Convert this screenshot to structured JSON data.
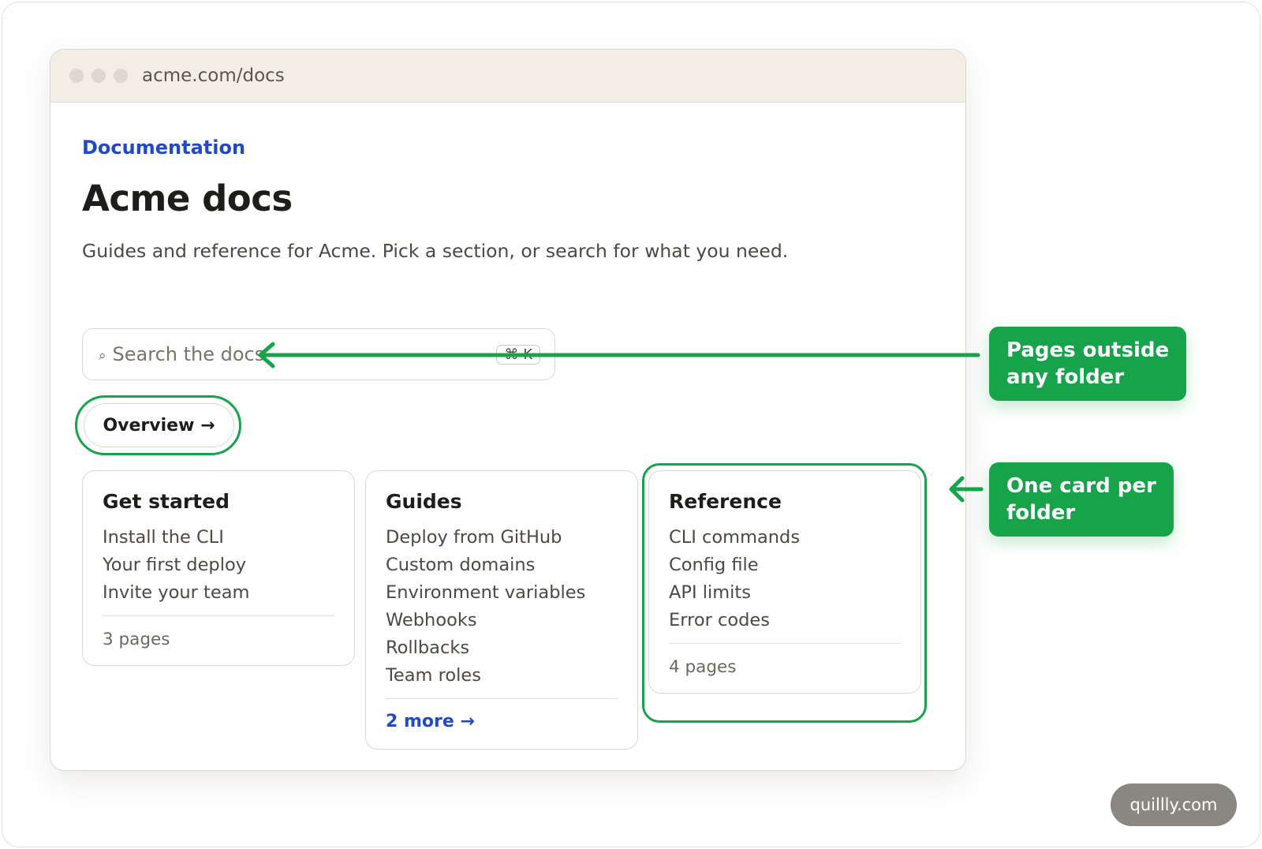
{
  "browser": {
    "url": "acme.com/docs"
  },
  "page": {
    "eyebrow": "Documentation",
    "title": "Acme docs",
    "subtitle": "Guides and reference for Acme. Pick a section, or search for what you need.",
    "search": {
      "placeholder": "Search the docs",
      "shortcut": "⌘ K",
      "icon": "search-icon"
    },
    "overview_label": "Overview →"
  },
  "cards": [
    {
      "title": "Get started",
      "items": [
        "Install the CLI",
        "Your first deploy",
        "Invite your team"
      ],
      "footer": "3 pages"
    },
    {
      "title": "Guides",
      "items": [
        "Deploy from GitHub",
        "Custom domains",
        "Environment variables",
        "Webhooks",
        "Rollbacks",
        "Team roles"
      ],
      "footer": "2 more →"
    },
    {
      "title": "Reference",
      "items": [
        "CLI commands",
        "Config file",
        "API limits",
        "Error codes"
      ],
      "footer": "4 pages"
    }
  ],
  "annotations": {
    "callout_1": {
      "line1": "Pages outside",
      "line2": "any folder"
    },
    "callout_2": {
      "line1": "One card per",
      "line2": "folder"
    }
  },
  "colors": {
    "accent_green": "#17a34a",
    "link_blue": "#2149c4",
    "titlebar": "#f2eee6"
  },
  "watermark": "quillly.com"
}
